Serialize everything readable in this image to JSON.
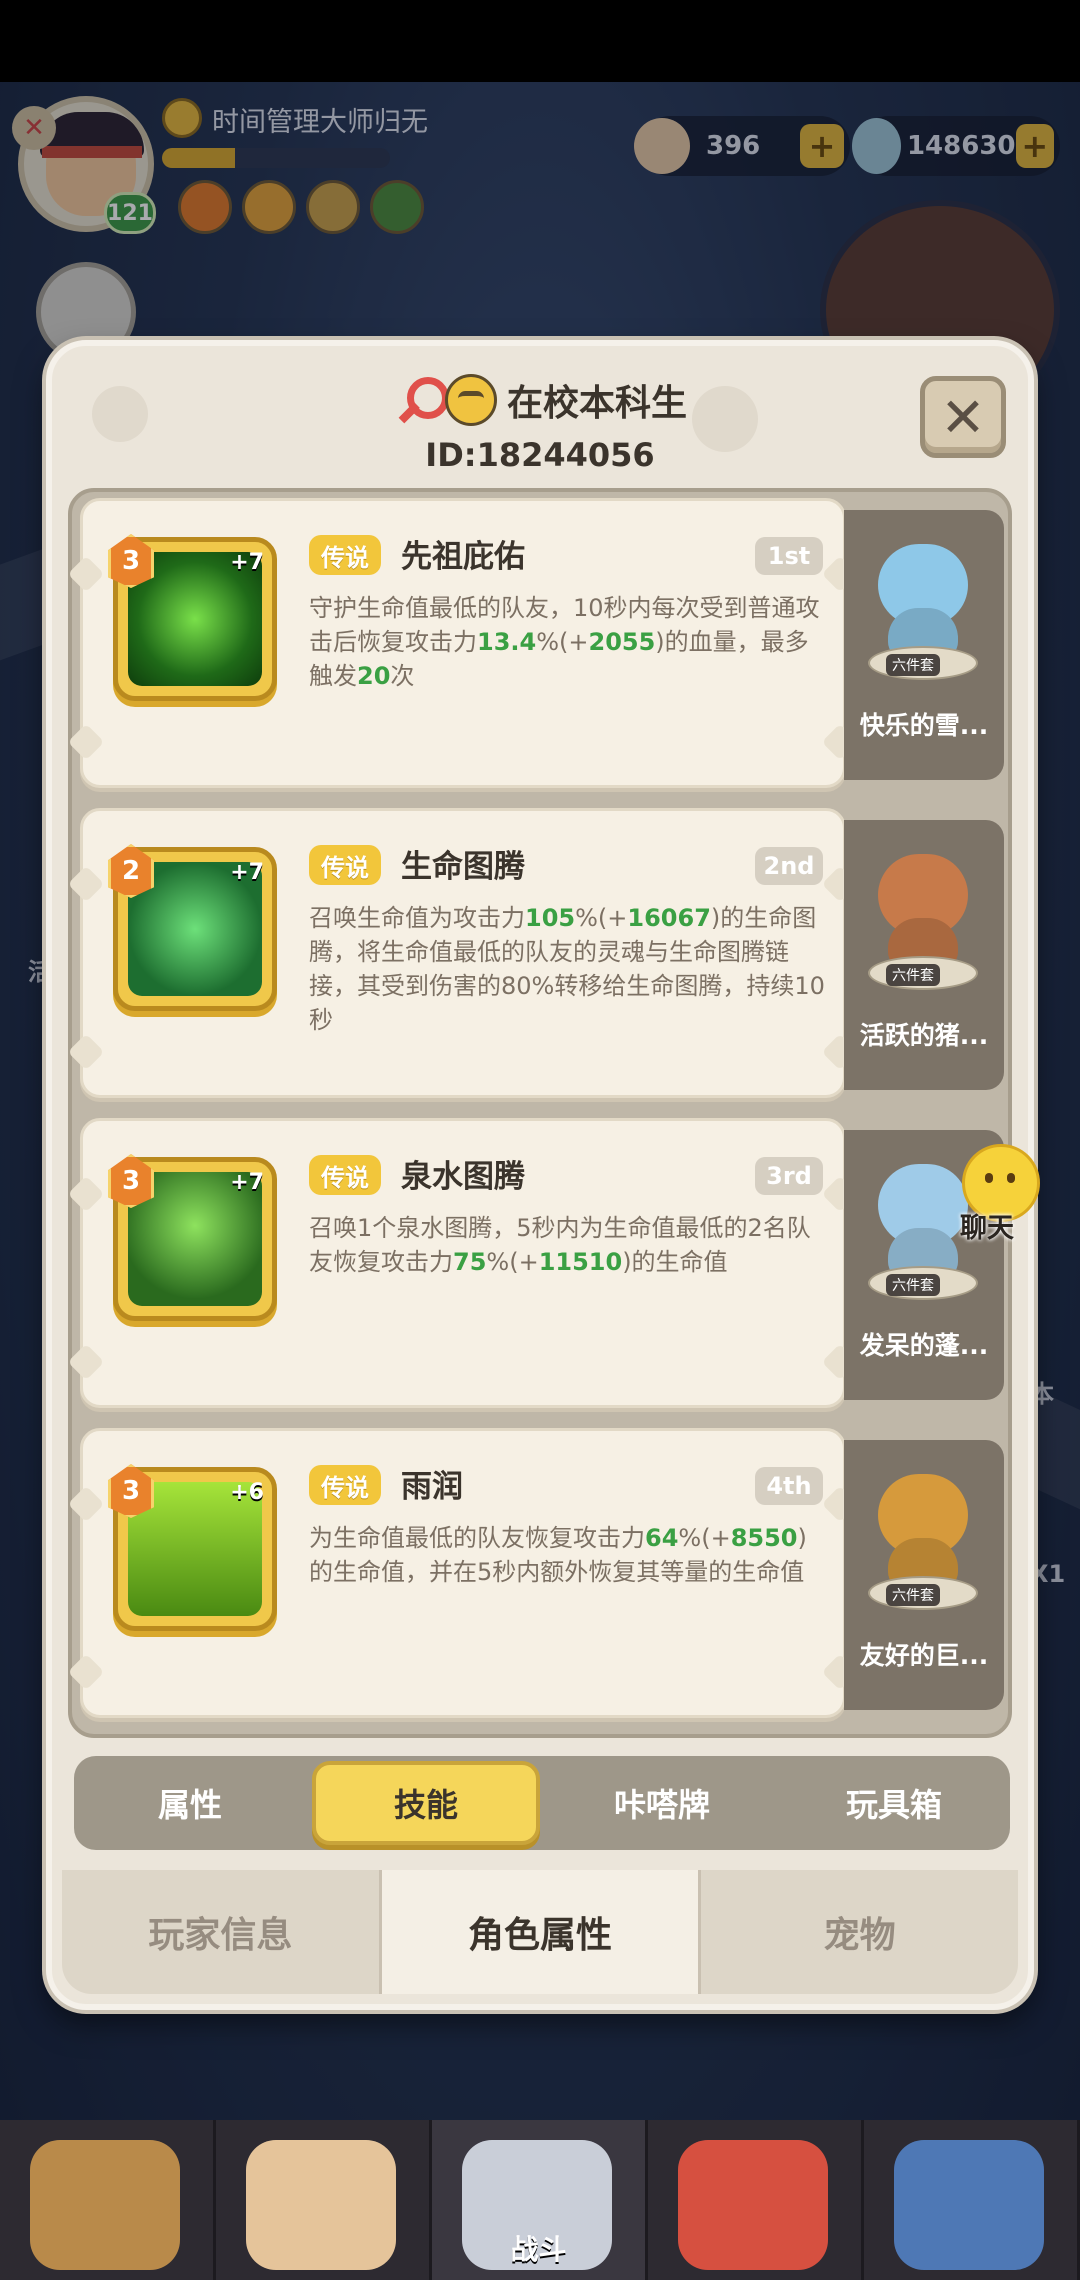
{
  "hud": {
    "player_name": "时间管理大师归无",
    "level": "121",
    "exp_fraction": 0.32,
    "currency": [
      {
        "icon": "shell-icon",
        "amount": "396"
      },
      {
        "icon": "pearl-icon",
        "amount": "148630"
      }
    ]
  },
  "dialog": {
    "title": "在校本科生",
    "id_text": "ID:18244056",
    "close_icon": "close-icon"
  },
  "skills": [
    {
      "rank": "3",
      "plus": "+7",
      "tag": "传说",
      "name": "先祖庇佑",
      "ordinal": "1st",
      "desc_parts": [
        "守护生命值最低的队友，10秒内每次受到普通攻击后恢复攻击力",
        "13.4",
        "%(+",
        "2055",
        ")的血量，最多触发",
        "20",
        "次"
      ],
      "icon": "shield-icon",
      "pet_name": "快乐的雪...",
      "set_tag": "六件套",
      "pet_color": "#8ec8e8"
    },
    {
      "rank": "2",
      "plus": "+7",
      "tag": "传说",
      "name": "生命图腾",
      "ordinal": "2nd",
      "desc_parts": [
        "召唤生命值为攻击力",
        "105",
        "%(+",
        "16067",
        ")的生命图腾，将生命值最低的队友的灵魂与生命图腾链接，其受到伤害的80%转移给生命图腾，持续10秒",
        "",
        ""
      ],
      "icon": "totem-icon",
      "pet_name": "活跃的猪...",
      "set_tag": "六件套",
      "pet_color": "#c77a4a"
    },
    {
      "rank": "3",
      "plus": "+7",
      "tag": "传说",
      "name": "泉水图腾",
      "ordinal": "3rd",
      "desc_parts": [
        "召唤1个泉水图腾，5秒内为生命值最低的2名队友恢复攻击力",
        "75",
        "%(+",
        "11510",
        ")的生命值",
        "",
        ""
      ],
      "icon": "fountain-totem-icon",
      "pet_name": "发呆的蓬...",
      "set_tag": "六件套",
      "pet_color": "#9fcbe8"
    },
    {
      "rank": "3",
      "plus": "+6",
      "tag": "传说",
      "name": "雨润",
      "ordinal": "4th",
      "desc_parts": [
        "为生命值最低的队友恢复攻击力",
        "64",
        "%(+",
        "8550",
        ")的生命值，并在5秒内额外恢复其等量的生命值",
        "",
        ""
      ],
      "icon": "heal-cross-icon",
      "pet_name": "友好的巨...",
      "set_tag": "六件套",
      "pet_color": "#d69a3c"
    }
  ],
  "subtabs": [
    {
      "label": "属性",
      "active": false
    },
    {
      "label": "技能",
      "active": true
    },
    {
      "label": "咔嗒牌",
      "active": false
    },
    {
      "label": "玩具箱",
      "active": false
    }
  ],
  "maintabs": [
    {
      "label": "玩家信息",
      "active": false
    },
    {
      "label": "角色属性",
      "active": true
    },
    {
      "label": "宠物",
      "active": false
    }
  ],
  "chat": {
    "label": "聊天"
  },
  "bottom_nav": [
    {
      "label": "",
      "icon": "hero-nav-icon"
    },
    {
      "label": "",
      "icon": "character-nav-icon"
    },
    {
      "label": "战斗",
      "icon": "battle-sword-icon"
    },
    {
      "label": "",
      "icon": "pet-nav-icon"
    },
    {
      "label": "",
      "icon": "shop-nav-icon"
    }
  ],
  "side_glyphs": [
    "活",
    "本",
    "X1"
  ],
  "colors": {
    "accent_yellow": "#f2c63b",
    "highlight_green": "#3aa043",
    "dialog_bg": "#ebe5da"
  }
}
